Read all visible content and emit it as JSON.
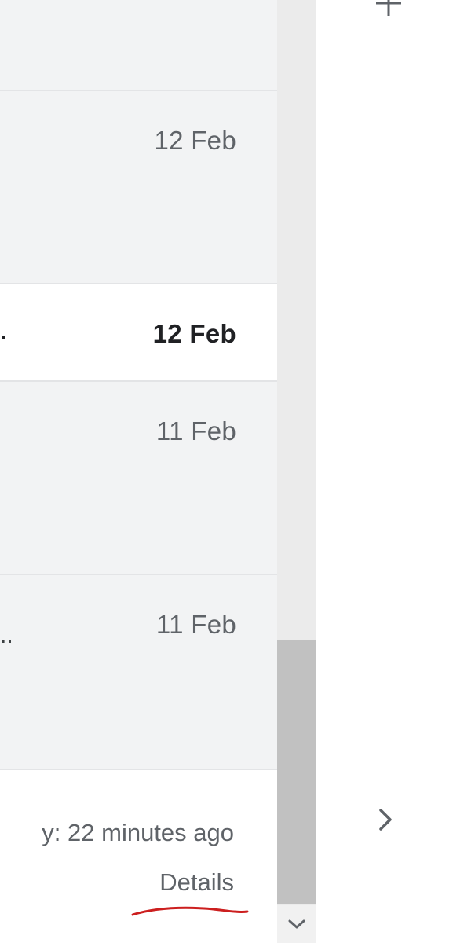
{
  "email_list": {
    "rows": [
      {
        "preview": "",
        "date": "12 Feb",
        "unread": false
      },
      {
        "preview": ".",
        "date": "12 Feb",
        "unread": true
      },
      {
        "preview": "",
        "date": "11 Feb",
        "unread": false
      },
      {
        "preview": "..",
        "date": "11 Feb",
        "unread": false
      }
    ]
  },
  "footer": {
    "activity_text": "y: 22 minutes ago",
    "details_label": "Details"
  },
  "icons": {
    "top_right": "plus-icon",
    "side_nav": "chevron-right-icon",
    "scroll_down": "chevron-down-icon"
  },
  "colors": {
    "list_background": "#f2f3f4",
    "unread_background": "#ffffff",
    "scroll_thumb": "#c1c1c1",
    "annotation_underline": "#cc1f1f"
  }
}
